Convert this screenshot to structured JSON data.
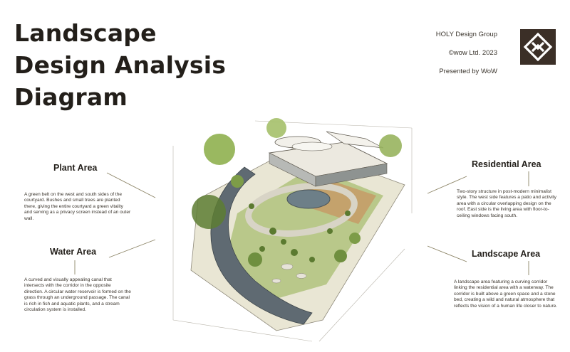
{
  "title_lines": [
    "Landscape",
    "Design Analysis",
    "Diagram"
  ],
  "meta": {
    "group": "HOLY Design Group",
    "copyright": "©wow Ltd. 2023",
    "presenter": "Presented by WoW"
  },
  "colors": {
    "text": "#231f1a",
    "logo": "#3b2f27",
    "leader": "#8c8466",
    "vegetation": "#7c9a4a",
    "water": "#5f6a72"
  },
  "sections": {
    "plant": {
      "title": "Plant Area",
      "description": "A green belt on the west and south sides of the courtyard. Bushes and small trees are planted there, giving the entire courtyard a green vitality and serving as a privacy screen instead of an outer wall."
    },
    "water": {
      "title": "Water Area",
      "description": "A curved and visually appealing canal that intersects with the corridor in the opposite direction. A circular water reservoir is formed on the grass through an underground passage. The canal is rich in fish and aquatic plants, and a stream circulation system is installed."
    },
    "residential": {
      "title": "Residential Area",
      "description": "Two-story structure in post-modern minimalist style. The west side features a patio and activity area with a circular overlapping design on the roof. East side is the living area with floor-to-ceiling windows facing south."
    },
    "landscape": {
      "title": "Landscape Area",
      "description": "A landscape area featuring a curving corridor linking the residential area with a waterway. The corridor is built above a green space and a stone bed, creating a wild and natural atmosphere that reflects the vision of a human life closer to nature."
    }
  }
}
